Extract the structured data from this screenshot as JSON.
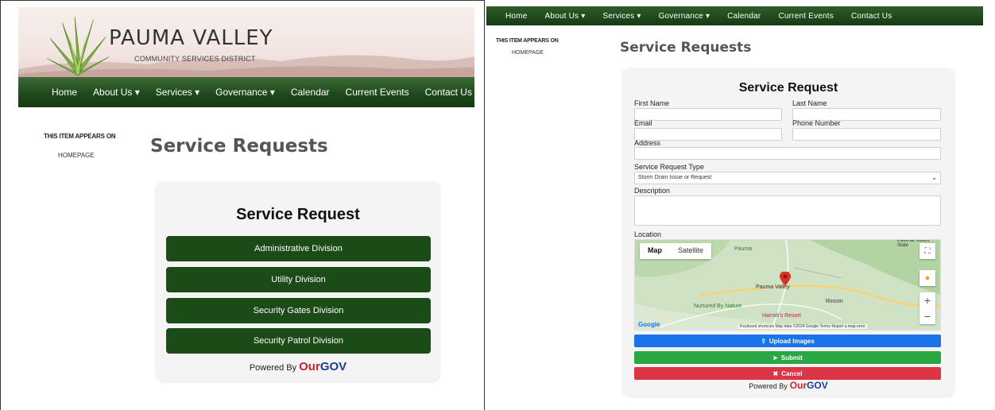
{
  "left": {
    "site_title": "PAUMA VALLEY",
    "site_subtitle": "COMMUNITY SERVICES DISTRICT",
    "nav": [
      "Home",
      "About Us ▾",
      "Services ▾",
      "Governance ▾",
      "Calendar",
      "Current Events",
      "Contact Us"
    ],
    "appears_on_label": "THIS ITEM APPEARS ON",
    "appears_on_link": "HOMEPAGE",
    "page_heading": "Service Requests",
    "card_title": "Service Request",
    "divisions": [
      "Administrative Division",
      "Utility Division",
      "Security Gates Division",
      "Security Patrol Division"
    ],
    "powered_by": "Powered By",
    "brand_our": "Our",
    "brand_gov": "GOV"
  },
  "right": {
    "nav": [
      "Home",
      "About Us ▾",
      "Services ▾",
      "Governance ▾",
      "Calendar",
      "Current Events",
      "Contact Us"
    ],
    "appears_on_label": "THIS ITEM APPEARS ON",
    "appears_on_link": "HOMEPAGE",
    "page_heading": "Service Requests",
    "card_title": "Service Request",
    "form": {
      "first_name": "First Name",
      "last_name": "Last Name",
      "email": "Email",
      "phone": "Phone Number",
      "address": "Address",
      "request_type_label": "Service Request Type",
      "request_type_value": "Storm Drain Issue or Request",
      "description": "Description",
      "location": "Location"
    },
    "map": {
      "tab_map": "Map",
      "tab_satellite": "Satellite",
      "place_pauma_valley": "Pauma Valley",
      "place_pauma": "Pauma",
      "place_nurtured": "Nurtured By Nature",
      "place_rincon": "Rincon",
      "place_harrahs": "Harrah's Resort",
      "place_palomar": "Palomar Mount State",
      "google": "Google",
      "footer": "Keyboard shortcuts   Map data ©2024 Google   Terms   Report a map error"
    },
    "buttons": {
      "upload": "Upload Images",
      "submit": "Submit",
      "cancel": "Cancel"
    },
    "powered_by": "Powered By",
    "brand_our": "Our",
    "brand_gov": "GOV"
  },
  "colors": {
    "nav_green": "#1f4a1c",
    "division_green": "#1b4b17",
    "upload_blue": "#1a73e8",
    "submit_green": "#28a745",
    "cancel_red": "#dc3545",
    "brand_red": "#c8242b",
    "brand_blue": "#1d3b8f"
  }
}
